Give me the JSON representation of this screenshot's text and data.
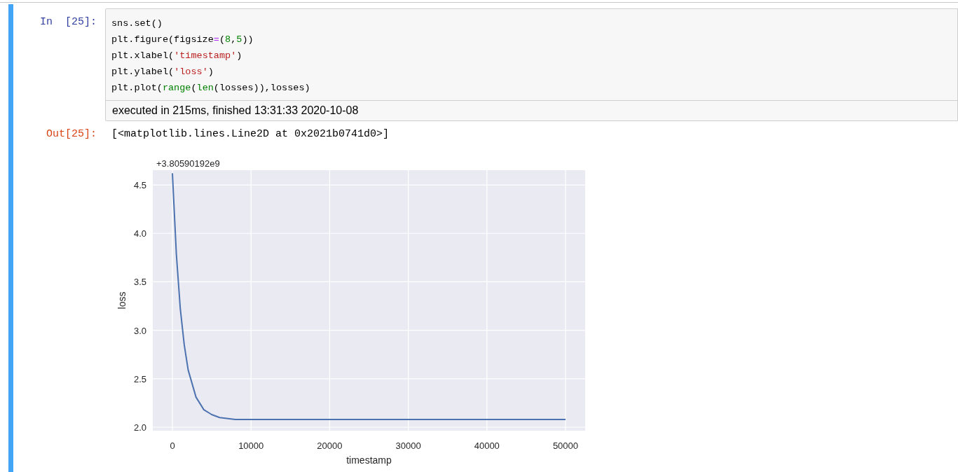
{
  "cell": {
    "in_prompt": "In  [25]:",
    "selected": true,
    "code_lines": [
      [
        {
          "kind": "plain",
          "text": "sns.set()"
        }
      ],
      [
        {
          "kind": "plain",
          "text": "plt.figure(figsize"
        },
        {
          "kind": "op",
          "text": "="
        },
        {
          "kind": "plain",
          "text": "("
        },
        {
          "kind": "num",
          "text": "8"
        },
        {
          "kind": "plain",
          "text": ","
        },
        {
          "kind": "num",
          "text": "5"
        },
        {
          "kind": "plain",
          "text": "))"
        }
      ],
      [
        {
          "kind": "plain",
          "text": "plt.xlabel("
        },
        {
          "kind": "str",
          "text": "'timestamp'"
        },
        {
          "kind": "plain",
          "text": ")"
        }
      ],
      [
        {
          "kind": "plain",
          "text": "plt.ylabel("
        },
        {
          "kind": "str",
          "text": "'loss'"
        },
        {
          "kind": "plain",
          "text": ")"
        }
      ],
      [
        {
          "kind": "plain",
          "text": "plt.plot("
        },
        {
          "kind": "builtin",
          "text": "range"
        },
        {
          "kind": "plain",
          "text": "("
        },
        {
          "kind": "builtin",
          "text": "len"
        },
        {
          "kind": "plain",
          "text": "(losses)),losses)"
        }
      ]
    ],
    "execution_info": "executed in 215ms, finished 13:31:33 2020-10-08",
    "out_prompt": "Out[25]:",
    "output_text": "[<matplotlib.lines.Line2D at 0x2021b0741d0>]",
    "chart_data": {
      "type": "line",
      "xlabel": "timestamp",
      "ylabel": "loss",
      "x": [
        0,
        500,
        1000,
        1500,
        2000,
        3000,
        4000,
        5000,
        6000,
        8000,
        10000,
        20000,
        30000,
        40000,
        50000
      ],
      "series": [
        {
          "color": "#4c72b0",
          "values": [
            4.62,
            3.78,
            3.22,
            2.85,
            2.59,
            2.31,
            2.18,
            2.13,
            2.1,
            2.08,
            2.08,
            2.08,
            2.08,
            2.08,
            2.08
          ]
        }
      ],
      "grid": true,
      "xlim": [
        -2500,
        52500
      ],
      "ylim": [
        1.964,
        4.652
      ],
      "xticks": [
        0,
        10000,
        20000,
        30000,
        40000,
        50000
      ],
      "yticks": [
        {
          "value": 2.0,
          "label": "2.0"
        },
        {
          "value": 2.5,
          "label": "2.5"
        },
        {
          "value": 3.0,
          "label": "3.0"
        },
        {
          "value": 3.5,
          "label": "3.5"
        },
        {
          "value": 4.0,
          "label": "4.0"
        },
        {
          "value": 4.5,
          "label": "4.5"
        }
      ],
      "annotations": [
        "+3.80590192e9"
      ]
    }
  }
}
